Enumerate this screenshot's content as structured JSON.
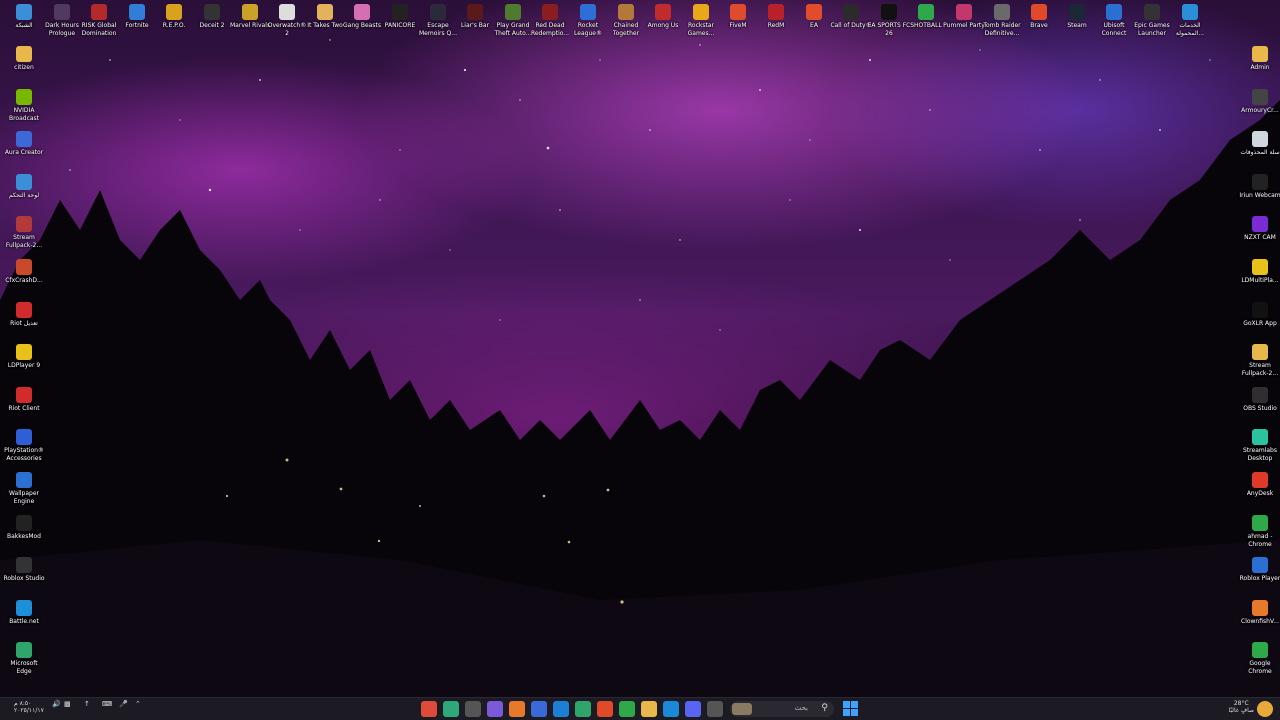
{
  "top_icons": [
    {
      "label": "الشبكة",
      "icon": "network-icon",
      "color": "#3a8fd6"
    },
    {
      "label": "Dark Hours Prologue",
      "icon": "game-icon",
      "color": "#503a60"
    },
    {
      "label": "RISK Global Domination",
      "icon": "game-icon",
      "color": "#b32a2a"
    },
    {
      "label": "Fortnite",
      "icon": "game-icon",
      "color": "#2f7ed8"
    },
    {
      "label": "R.E.P.O.",
      "icon": "game-icon",
      "color": "#d9a21d"
    },
    {
      "label": "Deceit 2",
      "icon": "game-icon",
      "color": "#333333"
    },
    {
      "label": "Marvel Rivals",
      "icon": "game-icon",
      "color": "#c9a227"
    },
    {
      "label": "Overwatch® 2",
      "icon": "game-icon",
      "color": "#dddddd"
    },
    {
      "label": "It Takes Two",
      "icon": "game-icon",
      "color": "#e2b35a"
    },
    {
      "label": "Gang Beasts",
      "icon": "game-icon",
      "color": "#d46fb4"
    },
    {
      "label": "PANICORE",
      "icon": "game-icon",
      "color": "#222222"
    },
    {
      "label": "Escape Memoirs Q...",
      "icon": "game-icon",
      "color": "#2a2a3a"
    },
    {
      "label": "Liar's Bar",
      "icon": "game-icon",
      "color": "#5a1a1a"
    },
    {
      "label": "Play Grand Theft Auto...",
      "icon": "game-icon",
      "color": "#4f7b2e"
    },
    {
      "label": "Red Dead Redemptio...",
      "icon": "game-icon",
      "color": "#8a1d1d"
    },
    {
      "label": "Rocket League®",
      "icon": "game-icon",
      "color": "#2d6fd6"
    },
    {
      "label": "Chained Together",
      "icon": "game-icon",
      "color": "#b27a3a"
    },
    {
      "label": "Among Us",
      "icon": "game-icon",
      "color": "#c22b2b"
    },
    {
      "label": "Rockstar Games...",
      "icon": "game-icon",
      "color": "#e8a819"
    },
    {
      "label": "FiveM",
      "icon": "game-icon",
      "color": "#e04b2e"
    },
    {
      "label": "RedM",
      "icon": "game-icon",
      "color": "#b8202a"
    },
    {
      "label": "EA",
      "icon": "game-icon",
      "color": "#e04c2c"
    },
    {
      "label": "Call of Duty®",
      "icon": "game-icon",
      "color": "#2b2b2b"
    },
    {
      "label": "EA SPORTS FC 26",
      "icon": "game-icon",
      "color": "#111111"
    },
    {
      "label": "SHOTBALL",
      "icon": "game-icon",
      "color": "#2ea84a"
    },
    {
      "label": "Pummel Party",
      "icon": "game-icon",
      "color": "#c2386b"
    },
    {
      "label": "Tomb Raider Definitive...",
      "icon": "game-icon",
      "color": "#6a6a6a"
    },
    {
      "label": "Brave",
      "icon": "brave-icon",
      "color": "#e0492a"
    },
    {
      "label": "Steam",
      "icon": "steam-icon",
      "color": "#1b2838"
    },
    {
      "label": "Ubisoft Connect",
      "icon": "ubisoft-icon",
      "color": "#2a6fd1"
    },
    {
      "label": "Epic Games Launcher",
      "icon": "epic-icon",
      "color": "#333333"
    },
    {
      "label": "الخدمات المحمولة...",
      "icon": "app-icon",
      "color": "#2a8fd6"
    }
  ],
  "left_icons": [
    {
      "label": "citizen",
      "icon": "folder-icon",
      "color": "#e8b94a"
    },
    {
      "label": "NVIDIA Broadcast",
      "icon": "nvidia-icon",
      "color": "#76b900"
    },
    {
      "label": "Aura Creator",
      "icon": "aura-icon",
      "color": "#3b6ad8"
    },
    {
      "label": "لوحة التحكم",
      "icon": "control-panel-icon",
      "color": "#3a8fd6"
    },
    {
      "label": "Stream Fullpack-2...",
      "icon": "archive-icon",
      "color": "#b33a3a"
    },
    {
      "label": "CfxCrashD...",
      "icon": "app-icon",
      "color": "#c94a2a"
    },
    {
      "label": "Riot تعديل",
      "icon": "riot-icon",
      "color": "#d12b2b"
    },
    {
      "label": "LDPlayer 9",
      "icon": "ldplayer-icon",
      "color": "#e8c21a"
    },
    {
      "label": "Riot Client",
      "icon": "riot-icon",
      "color": "#d12b2b"
    },
    {
      "label": "PlayStation® Accessories",
      "icon": "playstation-icon",
      "color": "#2f5fd6"
    },
    {
      "label": "Wallpaper Engine",
      "icon": "wallpaper-icon",
      "color": "#2a6fd1"
    },
    {
      "label": "BakkesMod",
      "icon": "bakkesmod-icon",
      "color": "#222222"
    },
    {
      "label": "Roblox Studio",
      "icon": "roblox-icon",
      "color": "#333333"
    },
    {
      "label": "Battle.net",
      "icon": "battlenet-icon",
      "color": "#1d8ed8"
    },
    {
      "label": "Microsoft Edge",
      "icon": "edge-icon",
      "color": "#2fa56b"
    }
  ],
  "right_icons": [
    {
      "label": "Admin",
      "icon": "folder-icon",
      "color": "#e8b94a"
    },
    {
      "label": "ArmouryCr...",
      "icon": "armoury-icon",
      "color": "#444444"
    },
    {
      "label": "سلة المحذوفات",
      "icon": "recycle-bin-icon",
      "color": "#cfd6de"
    },
    {
      "label": "Iriun Webcam",
      "icon": "webcam-icon",
      "color": "#222222"
    },
    {
      "label": "NZXT CAM",
      "icon": "nzxt-icon",
      "color": "#7a2bd6"
    },
    {
      "label": "LDMultiPla...",
      "icon": "ldplayer-icon",
      "color": "#e8c21a"
    },
    {
      "label": "GoXLR App",
      "icon": "goxlr-icon",
      "color": "#111111"
    },
    {
      "label": "Stream Fullpack-2...",
      "icon": "folder-icon",
      "color": "#e8b94a"
    },
    {
      "label": "OBS Studio",
      "icon": "obs-icon",
      "color": "#302e31"
    },
    {
      "label": "Streamlabs Desktop",
      "icon": "streamlabs-icon",
      "color": "#2bc2a0"
    },
    {
      "label": "AnyDesk",
      "icon": "anydesk-icon",
      "color": "#e0392a"
    },
    {
      "label": "ahmad - Chrome",
      "icon": "chrome-icon",
      "color": "#2fa84a"
    },
    {
      "label": "Roblox Player",
      "icon": "roblox-icon",
      "color": "#2a6fd1"
    },
    {
      "label": "ClownfishV...",
      "icon": "clownfish-icon",
      "color": "#e8782a"
    },
    {
      "label": "Google Chrome",
      "icon": "chrome-icon",
      "color": "#2fa84a"
    }
  ],
  "taskbar": {
    "start_icon": "windows-start-icon",
    "search": {
      "placeholder": "بحث"
    },
    "apps": [
      {
        "icon": "app-1-icon",
        "color": "#e04a3a"
      },
      {
        "icon": "app-2-icon",
        "color": "#2ea87a"
      },
      {
        "icon": "app-3-icon",
        "color": "#555555"
      },
      {
        "icon": "app-4-icon",
        "color": "#7a5ad8"
      },
      {
        "icon": "app-5-icon",
        "color": "#e8782a"
      },
      {
        "icon": "app-6-icon",
        "color": "#3a6ad8"
      },
      {
        "icon": "app-7-icon",
        "color": "#1d7ed8"
      },
      {
        "icon": "edge-icon",
        "color": "#2fa56b"
      },
      {
        "icon": "brave-icon",
        "color": "#e0492a"
      },
      {
        "icon": "chrome-icon",
        "color": "#2fa84a"
      },
      {
        "icon": "file-explorer-icon",
        "color": "#e8b94a"
      },
      {
        "icon": "steam-icon",
        "color": "#1b88d8"
      },
      {
        "icon": "discord-icon",
        "color": "#5865f2"
      },
      {
        "icon": "app-8-icon",
        "color": "#555555"
      }
    ],
    "tray_left": {
      "time": "٨:٥٠ م",
      "date": "٢٠٢٥/١١/١٧"
    },
    "weather": {
      "temp": "28°C",
      "condition": "صافٍ غالبًا"
    }
  }
}
